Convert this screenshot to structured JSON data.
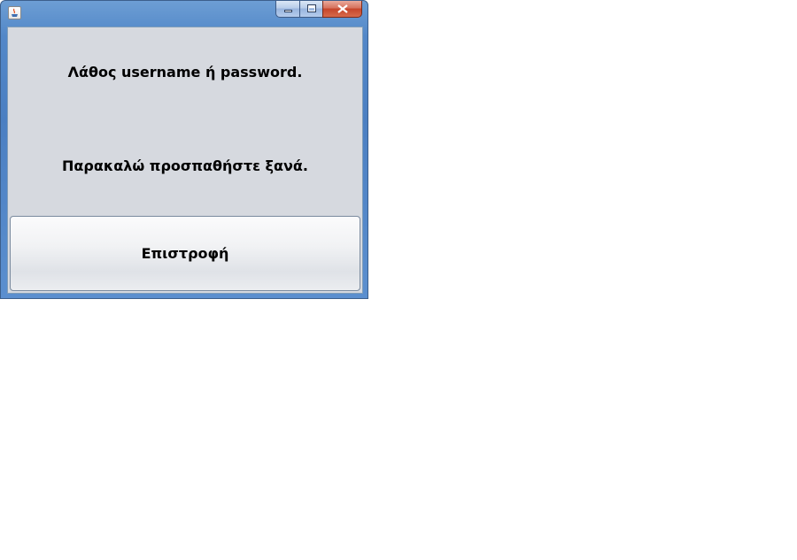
{
  "window": {
    "icon": "java-icon",
    "controls": {
      "minimize": "minimize-icon",
      "maximize": "maximize-icon",
      "close": "close-icon"
    }
  },
  "dialog": {
    "message_line1": "Λάθος username ή password.",
    "message_line2": "Παρακαλώ προσπαθήστε ξανά.",
    "back_button_label": "Επιστροφή"
  },
  "colors": {
    "titlebar": "#5287c8",
    "client_background": "#d6d9df",
    "close_button": "#c6452a"
  }
}
